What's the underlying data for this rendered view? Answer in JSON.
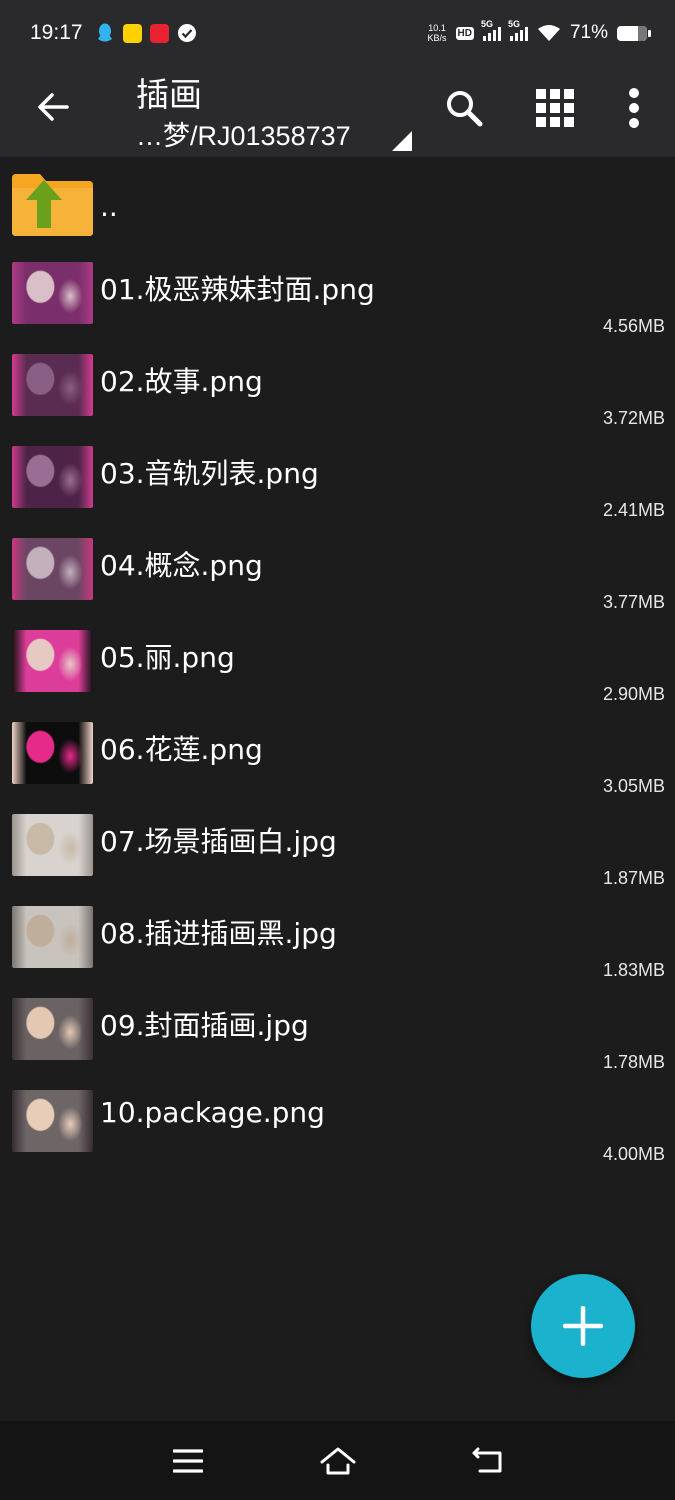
{
  "status_bar": {
    "time": "19:17",
    "net_speed_value": "10.1",
    "net_speed_unit": "KB/s",
    "hd_label": "HD",
    "sim1_label": "5G",
    "sim2_label": "5G",
    "battery_percent": "71%",
    "battery_level": 0.71
  },
  "app_bar": {
    "title": "插画",
    "path": "…梦/RJ01358737"
  },
  "parent_entry": {
    "label": ".."
  },
  "files": [
    {
      "name": "01.极恶辣妹封面.png",
      "size": "4.56MB",
      "thumb_colors": [
        "#7a2f6a",
        "#d9bfc8",
        "#ad3a86"
      ]
    },
    {
      "name": "02.故事.png",
      "size": "3.72MB",
      "thumb_colors": [
        "#5b2c52",
        "#8a5f86",
        "#d23b8e"
      ]
    },
    {
      "name": "03.音轨列表.png",
      "size": "2.41MB",
      "thumb_colors": [
        "#4d2447",
        "#9a6d95",
        "#cc3b8d"
      ]
    },
    {
      "name": "04.概念.png",
      "size": "3.77MB",
      "thumb_colors": [
        "#6b4663",
        "#c4b0bd",
        "#c9387f"
      ]
    },
    {
      "name": "05.丽.png",
      "size": "2.90MB",
      "thumb_colors": [
        "#dd3d9a",
        "#e7c9c4",
        "#121212"
      ]
    },
    {
      "name": "06.花莲.png",
      "size": "3.05MB",
      "thumb_colors": [
        "#0d0d0d",
        "#e62a8a",
        "#f0d2c6"
      ]
    },
    {
      "name": "07.场景插画白.jpg",
      "size": "1.87MB",
      "thumb_colors": [
        "#d8d3cf",
        "#c9b9a7",
        "#9a948f"
      ]
    },
    {
      "name": "08.插进插画黑.jpg",
      "size": "1.83MB",
      "thumb_colors": [
        "#c9c3be",
        "#bfae9b",
        "#7a7572"
      ]
    },
    {
      "name": "09.封面插画.jpg",
      "size": "1.78MB",
      "thumb_colors": [
        "#6a6263",
        "#e4c8b2",
        "#3a3234"
      ]
    },
    {
      "name": "10.package.png",
      "size": "4.00MB",
      "thumb_colors": [
        "#6e6567",
        "#e8cdb8",
        "#352d30"
      ]
    }
  ],
  "icons": {
    "back": "arrow-left-icon",
    "search": "search-icon",
    "grid": "grid-view-icon",
    "more": "more-vert-icon",
    "fab": "plus-icon",
    "nav_menu": "menu-icon",
    "nav_home": "home-icon",
    "nav_back": "back-nav-icon"
  },
  "colors": {
    "background": "#1c1c1d",
    "app_bar": "#2a2a2c",
    "fab": "#1ab2cc",
    "folder": "#f5a623",
    "folder_arrow": "#6aa01c"
  }
}
